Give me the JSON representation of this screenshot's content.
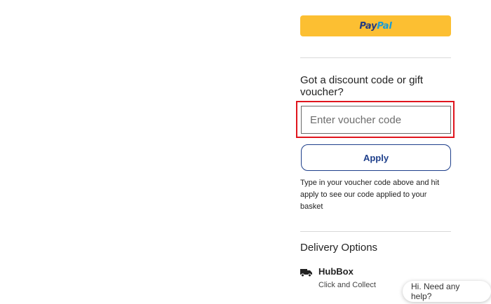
{
  "paypal": {
    "pay": "Pay",
    "pal": "Pal"
  },
  "discount": {
    "title": "Got a discount code or gift voucher?",
    "input_placeholder": "Enter voucher code",
    "input_value": "",
    "apply_label": "Apply",
    "help_text": "Type in your voucher code above and hit apply to see our code applied to your basket"
  },
  "delivery": {
    "title": "Delivery Options",
    "option_name": "HubBox",
    "option_sub": "Click and Collect",
    "option_icon": "truck-icon"
  },
  "chat": {
    "label": "Hi. Need any help?"
  },
  "colors": {
    "paypal_bg": "#fcbf32",
    "accent": "#1e3f8b",
    "highlight": "#e0151d"
  }
}
